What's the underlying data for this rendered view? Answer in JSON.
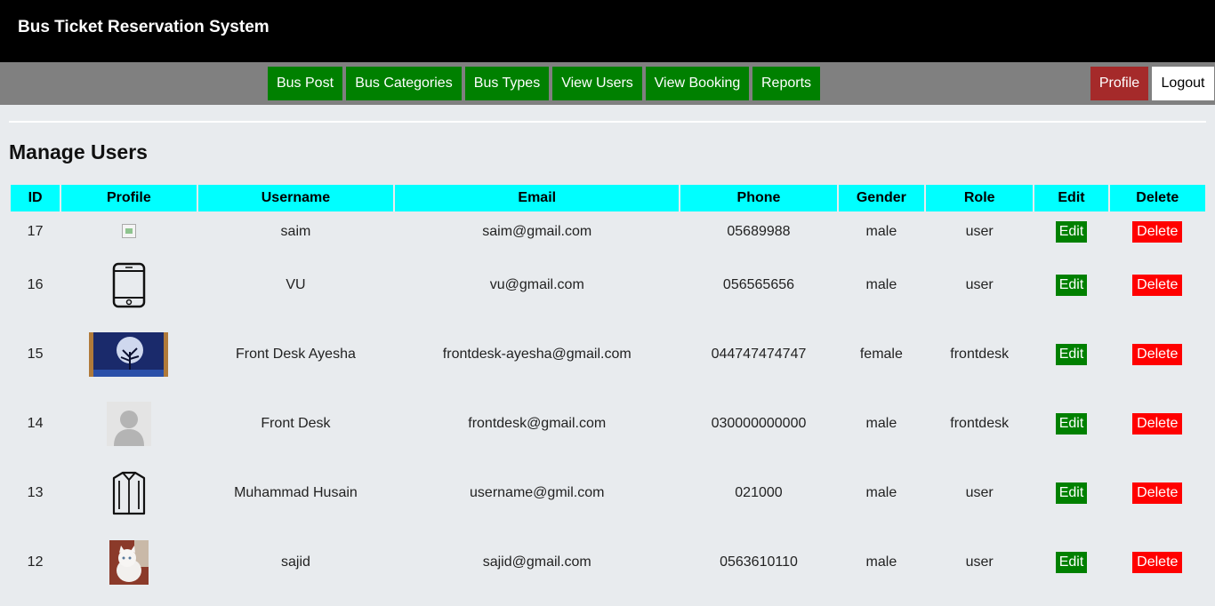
{
  "app": {
    "title": "Bus Ticket Reservation System"
  },
  "nav": {
    "items": [
      {
        "label": "Bus Post"
      },
      {
        "label": "Bus Categories"
      },
      {
        "label": "Bus Types"
      },
      {
        "label": "View Users"
      },
      {
        "label": "View Booking"
      },
      {
        "label": "Reports"
      }
    ],
    "profile_label": "Profile",
    "logout_label": "Logout"
  },
  "page": {
    "title": "Manage Users"
  },
  "table": {
    "headers": [
      "ID",
      "Profile",
      "Username",
      "Email",
      "Phone",
      "Gender",
      "Role",
      "Edit",
      "Delete"
    ],
    "edit_label": "Edit",
    "delete_label": "Delete",
    "rows": [
      {
        "id": "17",
        "profile": "broken-image-icon",
        "username": "saim",
        "email": "saim@gmail.com",
        "phone": "05689988",
        "gender": "male",
        "role": "user"
      },
      {
        "id": "16",
        "profile": "phone-icon",
        "username": "VU",
        "email": "vu@gmail.com",
        "phone": "056565656",
        "gender": "male",
        "role": "user"
      },
      {
        "id": "15",
        "profile": "moon-tree-photo",
        "username": "Front Desk Ayesha",
        "email": "frontdesk-ayesha@gmail.com",
        "phone": "044747474747",
        "gender": "female",
        "role": "frontdesk"
      },
      {
        "id": "14",
        "profile": "default-avatar",
        "username": "Front Desk",
        "email": "frontdesk@gmail.com",
        "phone": "030000000000",
        "gender": "male",
        "role": "frontdesk"
      },
      {
        "id": "13",
        "profile": "shirt-icon",
        "username": "Muhammad Husain",
        "email": "username@gmil.com",
        "phone": "021000",
        "gender": "male",
        "role": "user"
      },
      {
        "id": "12",
        "profile": "cat-photo",
        "username": "sajid",
        "email": "sajid@gmail.com",
        "phone": "0563610110",
        "gender": "male",
        "role": "user"
      }
    ]
  },
  "colors": {
    "header_bg": "#000000",
    "nav_bg": "#808080",
    "nav_button": "#008000",
    "profile_button": "#a52a2a",
    "table_header": "#00ffff",
    "edit_button": "#008000",
    "delete_button": "#ff0000"
  }
}
